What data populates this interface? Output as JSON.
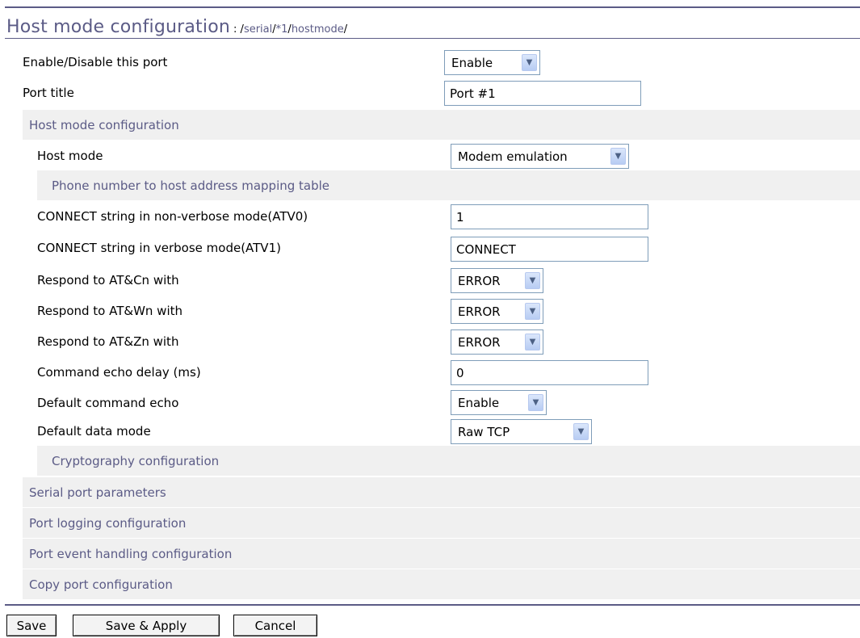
{
  "header": {
    "title": "Host mode configuration",
    "crumb_sep0": ":",
    "crumb_slash1": "/",
    "crumb_serial": "serial",
    "crumb_slash2": "/",
    "crumb_port": "*1",
    "crumb_slash3": "/",
    "crumb_hostmode": "hostmode",
    "crumb_slash4": "/"
  },
  "rows": {
    "enable_label": "Enable/Disable this port",
    "enable_value": "Enable",
    "title_label": "Port title",
    "title_value": "Port #1",
    "host_mode_label": "Host mode",
    "host_mode_value": "Modem emulation",
    "connect_nv_label": "CONNECT string in non-verbose mode(ATV0)",
    "connect_nv_value": "1",
    "connect_v_label": "CONNECT string in verbose mode(ATV1)",
    "connect_v_value": "CONNECT",
    "atc_label": "Respond to AT&Cn with",
    "atc_value": "ERROR",
    "atw_label": "Respond to AT&Wn with",
    "atw_value": "ERROR",
    "atz_label": "Respond to AT&Zn with",
    "atz_value": "ERROR",
    "echo_delay_label": "Command echo delay (ms)",
    "echo_delay_value": "0",
    "echo_label": "Default command echo",
    "echo_value": "Enable",
    "data_mode_label": "Default data mode",
    "data_mode_value": "Raw TCP"
  },
  "sections": {
    "host_mode_config": "Host mode configuration",
    "phone_mapping": "Phone number to host address mapping table",
    "crypto": "Cryptography configuration",
    "serial_params": "Serial port parameters",
    "logging": "Port logging configuration",
    "event": "Port event handling configuration",
    "copy": "Copy port configuration"
  },
  "buttons": {
    "save": "Save",
    "save_apply": "Save & Apply",
    "cancel": "Cancel"
  },
  "colors": {
    "accent": "#5b5b86",
    "section_bg": "#f0f0f0",
    "input_border": "#7f9db9"
  }
}
